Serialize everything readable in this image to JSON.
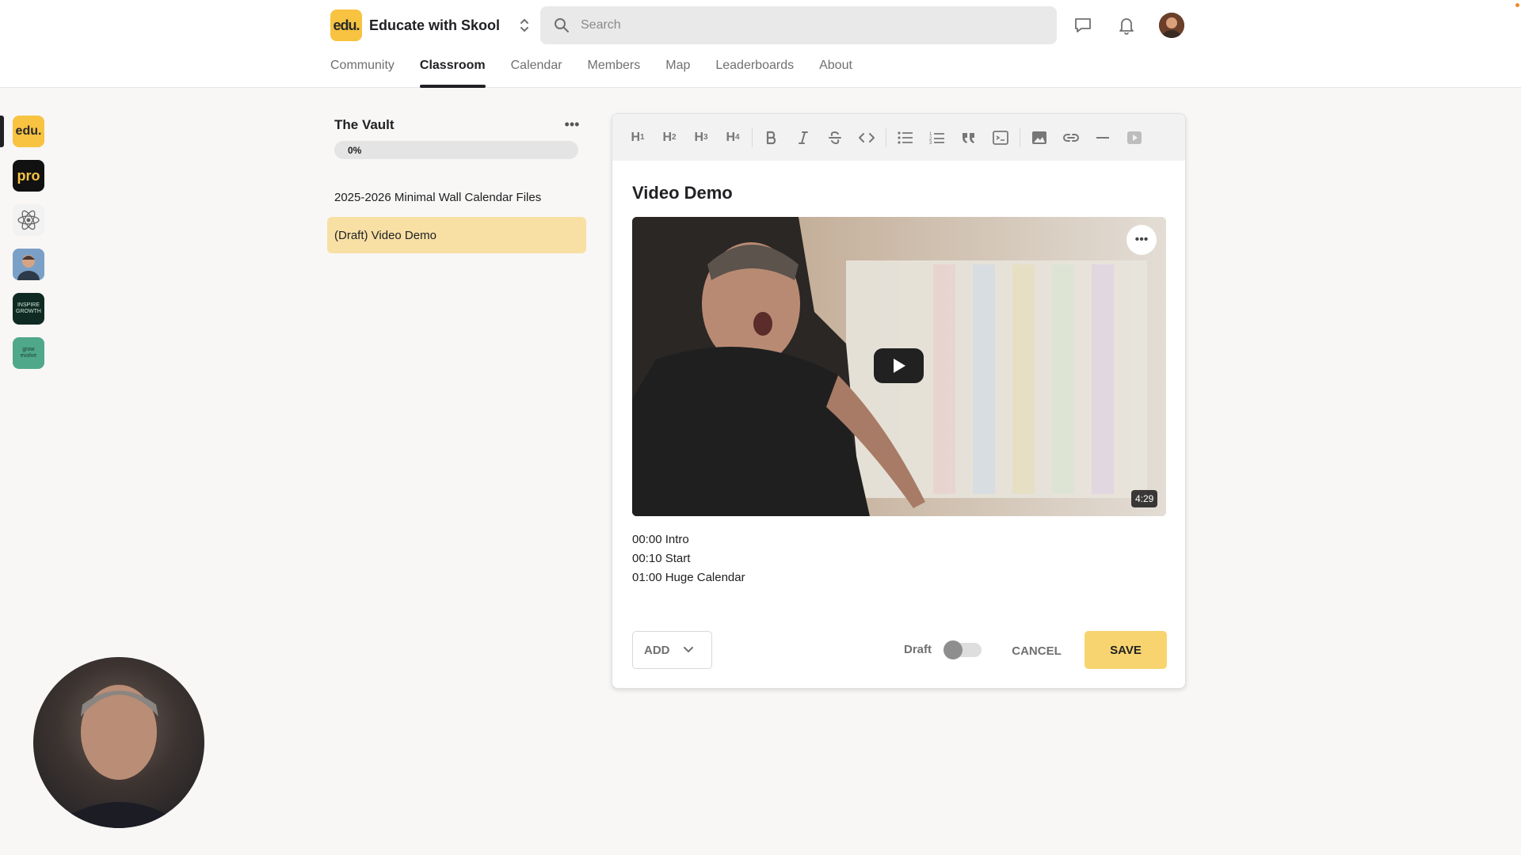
{
  "header": {
    "brand_logo_text": "edu.",
    "brand_name": "Educate with Skool",
    "search_placeholder": "Search",
    "tabs": [
      {
        "label": "Community",
        "active": false
      },
      {
        "label": "Classroom",
        "active": true
      },
      {
        "label": "Calendar",
        "active": false
      },
      {
        "label": "Members",
        "active": false
      },
      {
        "label": "Map",
        "active": false
      },
      {
        "label": "Leaderboards",
        "active": false
      },
      {
        "label": "About",
        "active": false
      }
    ]
  },
  "rail": {
    "items": [
      {
        "name": "community-edu",
        "text": "edu.",
        "bg": "#f8c341",
        "fg": "#2a2a2a"
      },
      {
        "name": "community-pro",
        "text": "pro",
        "bg": "#111111",
        "fg": "#f8c341"
      },
      {
        "name": "community-atom",
        "text": "",
        "bg": "#f2f2f2",
        "fg": "#555555"
      },
      {
        "name": "community-person",
        "text": "",
        "bg": "#6a8fb8",
        "fg": "#ffffff"
      },
      {
        "name": "community-inspire",
        "text": "INSPIRE GROWTH",
        "bg": "#0f2a22",
        "fg": "#cfe8d8"
      },
      {
        "name": "community-grow",
        "text": "grow evolve",
        "bg": "#4fa88a",
        "fg": "#1d3b30"
      }
    ]
  },
  "course": {
    "title": "The Vault",
    "progress": 0,
    "progress_label": "0%",
    "lessons": [
      {
        "label": "2025-2026 Minimal Wall Calendar Files",
        "active": false
      },
      {
        "label": "(Draft) Video Demo",
        "active": true
      }
    ]
  },
  "editor": {
    "toolbar": {
      "headings": [
        {
          "name": "heading-1-button",
          "label": "H",
          "level": "1"
        },
        {
          "name": "heading-2-button",
          "label": "H",
          "level": "2"
        },
        {
          "name": "heading-3-button",
          "label": "H",
          "level": "3"
        },
        {
          "name": "heading-4-button",
          "label": "H",
          "level": "4"
        }
      ],
      "format_icons": [
        "bold-icon",
        "italic-icon",
        "strikethrough-icon",
        "code-icon"
      ],
      "block_icons": [
        "bullet-list-icon",
        "numbered-list-icon",
        "quote-icon",
        "code-block-icon"
      ],
      "insert_icons": [
        "image-icon",
        "link-icon",
        "divider-icon",
        "video-icon"
      ]
    },
    "lesson_title": "Video Demo",
    "video": {
      "duration": "4:29",
      "menu_icon": "more-horizontal-icon",
      "play_icon": "play-icon"
    },
    "chapters": [
      "00:00 Intro",
      "00:10 Start",
      "01:00 Huge Calendar"
    ],
    "add_label": "ADD",
    "draft_label": "Draft",
    "draft_enabled": false,
    "cancel_label": "CANCEL",
    "save_label": "SAVE"
  },
  "colors": {
    "accent": "#f8d470",
    "brand": "#f8c341",
    "active_lesson": "#f8e0a5"
  }
}
